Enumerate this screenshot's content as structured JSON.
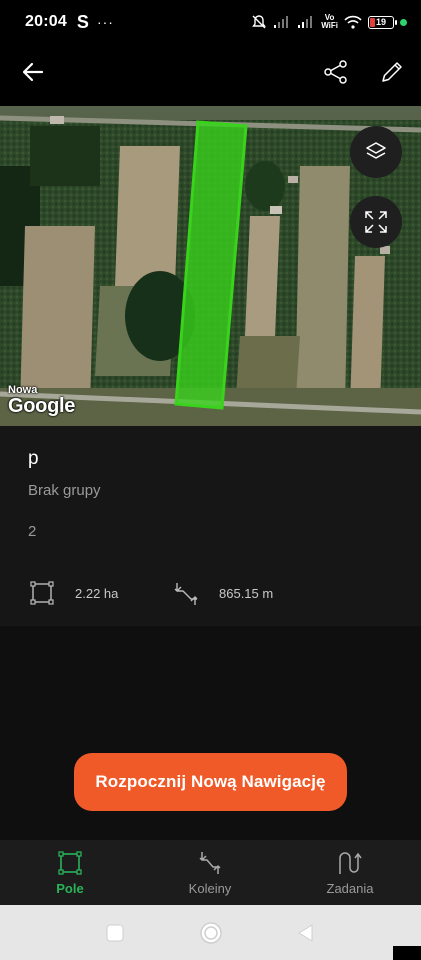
{
  "status_bar": {
    "time": "20:04",
    "carrier_icon": "S",
    "more": "···",
    "volte_top": "Vo",
    "volte_bottom": "WiFi",
    "battery": "19",
    "colors": {
      "battery_low": "#e0403a",
      "dot": "#2ed36b"
    }
  },
  "app_bar": {
    "back_icon": "arrow-left-icon",
    "share_icon": "share-icon",
    "edit_icon": "pencil-icon"
  },
  "map": {
    "layers_icon": "layers-icon",
    "expand_icon": "expand-icon",
    "attribution_small": "Nowa",
    "attribution_logo": "Google",
    "field_color": "#39d31c"
  },
  "field": {
    "name": "p",
    "group": "Brak grupy",
    "number": "2",
    "area": "2.22 ha",
    "length": "865.15 m"
  },
  "cta": {
    "label": "Rozpocznij Nową Nawigację",
    "color": "#f05a28"
  },
  "bottom_nav": {
    "items": [
      {
        "label": "Pole",
        "icon": "field-polygon-icon",
        "active": true
      },
      {
        "label": "Koleiny",
        "icon": "tracks-icon",
        "active": false
      },
      {
        "label": "Zadania",
        "icon": "tasks-route-icon",
        "active": false
      }
    ],
    "active_color": "#29b35a"
  },
  "system_nav": {
    "recents_icon": "square-icon",
    "home_icon": "circle-icon",
    "back_icon": "triangle-back-icon"
  }
}
